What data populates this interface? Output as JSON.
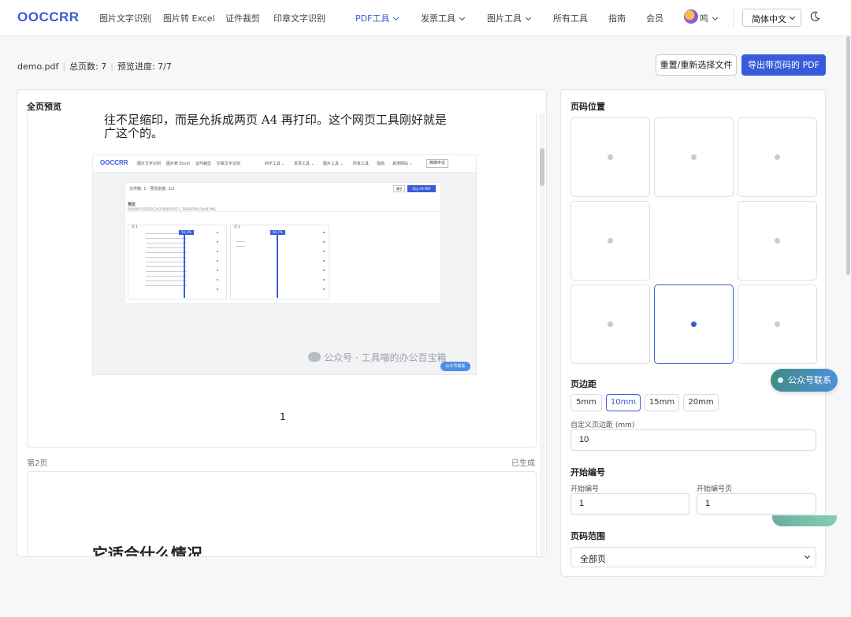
{
  "app": {
    "logo": "OOCCRR"
  },
  "nav": {
    "items": [
      {
        "label": "图片文字识别"
      },
      {
        "label": "图片转 Excel"
      },
      {
        "label": "证件裁剪"
      },
      {
        "label": "印章文字识别"
      },
      {
        "label": "PDF工具",
        "active": true
      },
      {
        "label": "发票工具"
      },
      {
        "label": "图片工具"
      },
      {
        "label": "所有工具"
      },
      {
        "label": "指南"
      },
      {
        "label": "会员"
      }
    ],
    "user_name": "鸣",
    "language": "简体中文",
    "theme_icon": "moon-icon",
    "active_color": "#3a5bd9"
  },
  "file": {
    "name": "demo.pdf",
    "total_pages": "总页数: 7",
    "progress": "预览进度: 7/7"
  },
  "actions": {
    "reset_label": "重置/重新选择文件",
    "export_label": "导出带页码的 PDF"
  },
  "preview": {
    "title": "全页预览",
    "page1": {
      "text_line1": "往不足缩印，而是允拆成两页 A4 再打印。这个网页工具刚好就是",
      "text_line2": "广这个的。",
      "page_number": "1"
    },
    "page2": {
      "label": "第2页",
      "status": "已生成",
      "heading": "它适合什么情况"
    },
    "screenshot": {
      "logo": "OOCCRR",
      "nav": [
        "图片文字识别",
        "图片转 Excel",
        "证件裁剪",
        "印章文字识别",
        "PDF工具 ⌄",
        "发票工具 ⌄",
        "图片工具 ⌄",
        "所有工具",
        "指南",
        "其他网站 ⌄"
      ],
      "language": "简体中文",
      "info": "文件数: 1 · 预览进度: 2/2",
      "reset": "清空",
      "export": "导出 A4 PDF",
      "section": "预览",
      "file_hash": "B4A69974D1B3C3A7584D5D2C1_7BB28786_D4A8.PNG",
      "page_a": "页 1",
      "page_b": "页 2",
      "tag_a": "50.2%",
      "tag_b": "64.7%",
      "watermark": "公众号 · 工具喵的办公百宝箱",
      "pill": "公众号联系"
    }
  },
  "settings": {
    "position_title": "页码位置",
    "positions": [
      {
        "id": "top-left",
        "selected": false
      },
      {
        "id": "top-center",
        "selected": false
      },
      {
        "id": "top-right",
        "selected": false
      },
      {
        "id": "middle-left",
        "selected": false
      },
      {
        "id": "middle-right",
        "selected": false
      },
      {
        "id": "bottom-left",
        "selected": false
      },
      {
        "id": "bottom-center",
        "selected": true
      },
      {
        "id": "bottom-right",
        "selected": false
      }
    ],
    "margin_title": "页边距",
    "margin_options": [
      {
        "label": "5mm",
        "active": false
      },
      {
        "label": "10mm",
        "active": true
      },
      {
        "label": "15mm",
        "active": false
      },
      {
        "label": "20mm",
        "active": false
      }
    ],
    "custom_margin_label": "自定义页边距 (mm)",
    "custom_margin_value": "10",
    "start_title": "开始编号",
    "start_number_label": "开始编号",
    "start_number_value": "1",
    "start_page_label": "开始编号页",
    "start_page_value": "1",
    "range_title": "页码范围",
    "range_value": "全部页"
  },
  "floating": {
    "contact_label": "公众号联系"
  }
}
